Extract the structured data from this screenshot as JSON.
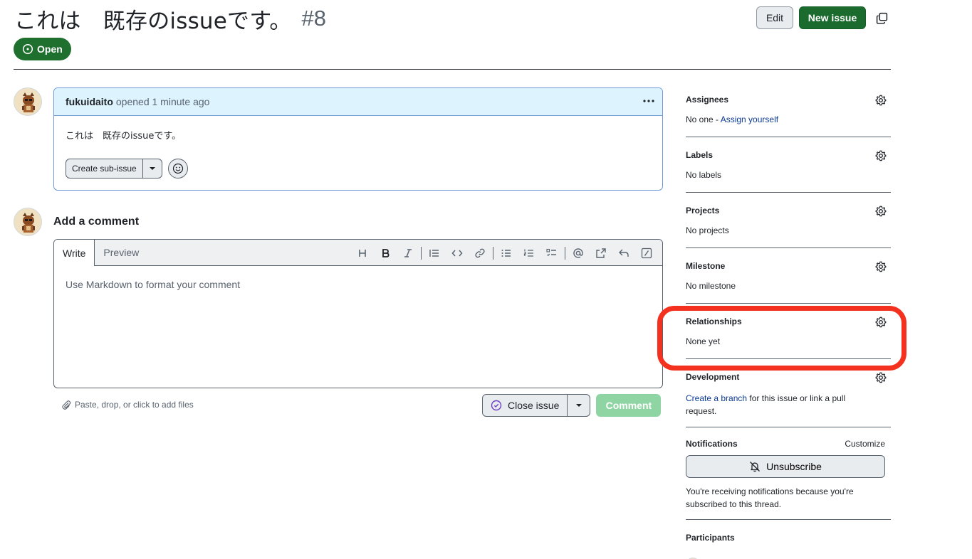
{
  "issue": {
    "title": "これは　既存のissueです。",
    "number": "#8",
    "state": "Open"
  },
  "header_actions": {
    "edit_label": "Edit",
    "new_issue_label": "New issue"
  },
  "comment": {
    "author": "fukuidaito",
    "meta": "opened 1 minute ago",
    "body": "これは　既存のissueです。",
    "create_sub_issue_label": "Create sub-issue"
  },
  "composer": {
    "title": "Add a comment",
    "tabs": [
      "Write",
      "Preview"
    ],
    "placeholder": "Use Markdown to format your comment",
    "attach_label": "Paste, drop, or click to add files",
    "close_issue_label": "Close issue",
    "comment_label": "Comment"
  },
  "sidebar": {
    "assignees": {
      "heading": "Assignees",
      "value_prefix": "No one - ",
      "link": "Assign yourself"
    },
    "labels": {
      "heading": "Labels",
      "value": "No labels"
    },
    "projects": {
      "heading": "Projects",
      "value": "No projects"
    },
    "milestone": {
      "heading": "Milestone",
      "value": "No milestone"
    },
    "relationships": {
      "heading": "Relationships",
      "value": "None yet"
    },
    "development": {
      "heading": "Development",
      "link": "Create a branch",
      "value_suffix": " for this issue or link a pull request."
    },
    "notifications": {
      "heading": "Notifications",
      "customize": "Customize",
      "unsubscribe_label": "Unsubscribe",
      "info": "You're receiving notifications because you're subscribed to this thread."
    },
    "participants": {
      "heading": "Participants"
    }
  },
  "colors": {
    "open_green": "#1f6f2f",
    "primary_green": "#1b6a2e",
    "comment_disabled": "#8fd5a3",
    "link_blue": "#0b3a94",
    "highlight_red": "#f4311f"
  }
}
